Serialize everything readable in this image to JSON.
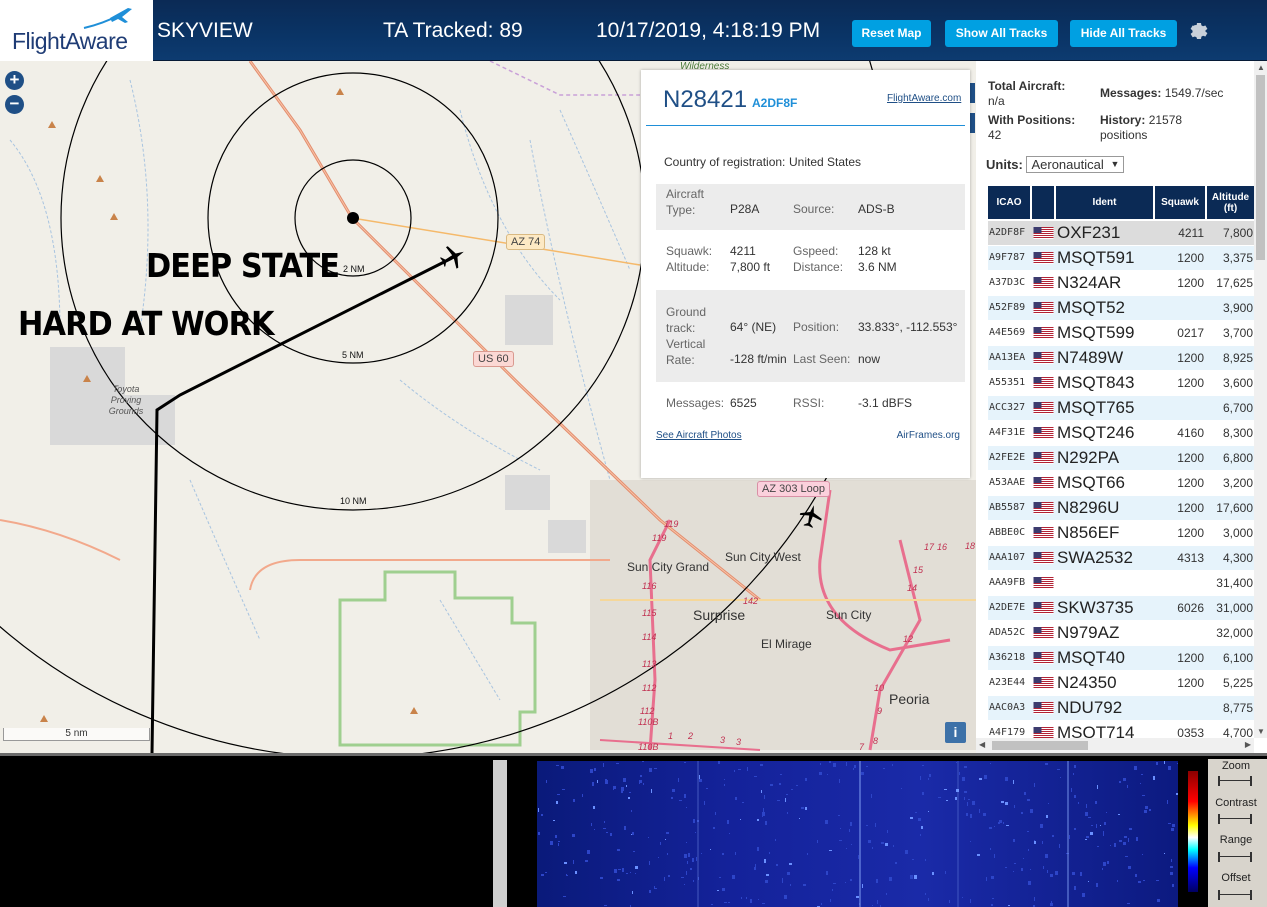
{
  "header": {
    "logo_text": "FlightAware",
    "site_name": "SKYVIEW",
    "tracked": "TA Tracked: 89",
    "datetime": "10/17/2019, 4:18:19 PM",
    "reset_label": "Reset Map",
    "show_label": "Show All Tracks",
    "hide_label": "Hide All Tracks",
    "settings_icon": "gear-icon"
  },
  "map": {
    "zoom_in": "+",
    "zoom_out": "−",
    "overlay_line1": "DEEP STATE",
    "overlay_line2": "HARD AT WORK",
    "ring_labels": [
      "2 NM",
      "5 NM",
      "10 NM"
    ],
    "road_labels": [
      "AZ 74",
      "US 60",
      "AZ 303 Loop"
    ],
    "places": [
      "Wilderness",
      "Toyota Proving Grounds",
      "Sun City West",
      "Sun City Grand",
      "Surprise",
      "Sun City",
      "El Mirage",
      "Peoria"
    ],
    "exit_numbers": [
      "119",
      "119",
      "116",
      "115",
      "114",
      "113",
      "112",
      "112",
      "110B",
      "110B",
      "142",
      "1",
      "2",
      "3",
      "3",
      "17",
      "16",
      "18",
      "15",
      "14",
      "12",
      "10",
      "9",
      "8",
      "7"
    ],
    "scale": "5 nm",
    "info_button": "i"
  },
  "popup": {
    "callsign": "N28421",
    "hex": "A2DF8F",
    "fa_link": "FlightAware.com",
    "country_label": "Country of registration:",
    "country": "United States",
    "aircraft_type_label": "Aircraft Type:",
    "aircraft_type": "P28A",
    "source_label": "Source:",
    "source": "ADS-B",
    "squawk_label": "Squawk:",
    "squawk": "4211",
    "gspeed_label": "Gspeed:",
    "gspeed": "128 kt",
    "altitude_label": "Altitude:",
    "altitude": "7,800 ft",
    "distance_label": "Distance:",
    "distance": "3.6 NM",
    "ground_track_label": "Ground track:",
    "ground_track": "64° (NE)",
    "position_label": "Position:",
    "position": "33.833°, -112.553°",
    "vertical_rate_label": "Vertical Rate:",
    "vertical_rate": "-128 ft/min",
    "last_seen_label": "Last Seen:",
    "last_seen": "now",
    "messages_label": "Messages:",
    "messages": "6525",
    "rssi_label": "RSSI:",
    "rssi": "-3.1 dBFS",
    "photos_link": "See Aircraft Photos",
    "airframes_link": "AirFrames.org"
  },
  "stats": {
    "total_label": "Total Aircraft:",
    "total": "n/a",
    "messages_label": "Messages:",
    "messages": "1549.7/sec",
    "positions_label": "With Positions:",
    "positions": "42",
    "history_label": "History:",
    "history": "21578",
    "history_unit": "positions",
    "units_label": "Units:",
    "units": "Aeronautical"
  },
  "table": {
    "headers": [
      "ICAO",
      "",
      "Ident",
      "Squawk",
      "Altitude (ft)"
    ],
    "rows": [
      {
        "icao": "A2DF8F",
        "ident": "OXF231",
        "squawk": "4211",
        "alt": "7,800"
      },
      {
        "icao": "A9F787",
        "ident": "MSQT591",
        "squawk": "1200",
        "alt": "3,375"
      },
      {
        "icao": "A37D3C",
        "ident": "N324AR",
        "squawk": "1200",
        "alt": "17,625"
      },
      {
        "icao": "A52F89",
        "ident": "MSQT52",
        "squawk": "",
        "alt": "3,900"
      },
      {
        "icao": "A4E569",
        "ident": "MSQT599",
        "squawk": "0217",
        "alt": "3,700"
      },
      {
        "icao": "AA13EA",
        "ident": "N7489W",
        "squawk": "1200",
        "alt": "8,925"
      },
      {
        "icao": "A55351",
        "ident": "MSQT843",
        "squawk": "1200",
        "alt": "3,600"
      },
      {
        "icao": "ACC327",
        "ident": "MSQT765",
        "squawk": "",
        "alt": "6,700"
      },
      {
        "icao": "A4F31E",
        "ident": "MSQT246",
        "squawk": "4160",
        "alt": "8,300"
      },
      {
        "icao": "A2FE2E",
        "ident": "N292PA",
        "squawk": "1200",
        "alt": "6,800"
      },
      {
        "icao": "A53AAE",
        "ident": "MSQT66",
        "squawk": "1200",
        "alt": "3,200"
      },
      {
        "icao": "AB5587",
        "ident": "N8296U",
        "squawk": "1200",
        "alt": "17,600"
      },
      {
        "icao": "ABBE0C",
        "ident": "N856EF",
        "squawk": "1200",
        "alt": "3,000"
      },
      {
        "icao": "AAA107",
        "ident": "SWA2532",
        "squawk": "4313",
        "alt": "4,300"
      },
      {
        "icao": "AAA9FB",
        "ident": "",
        "squawk": "",
        "alt": "31,400"
      },
      {
        "icao": "A2DE7E",
        "ident": "SKW3735",
        "squawk": "6026",
        "alt": "31,000"
      },
      {
        "icao": "ADA52C",
        "ident": "N979AZ",
        "squawk": "",
        "alt": "32,000"
      },
      {
        "icao": "A36218",
        "ident": "MSQT40",
        "squawk": "1200",
        "alt": "6,100"
      },
      {
        "icao": "A23E44",
        "ident": "N24350",
        "squawk": "1200",
        "alt": "5,225"
      },
      {
        "icao": "AAC0A3",
        "ident": "NDU792",
        "squawk": "",
        "alt": "8,775"
      },
      {
        "icao": "A4F179",
        "ident": "MSQT714",
        "squawk": "0353",
        "alt": "4,700"
      }
    ]
  },
  "spectrum": {
    "zoom_label": "Zoom",
    "contrast_label": "Contrast",
    "range_label": "Range",
    "offset_label": "Offset"
  },
  "colors": {
    "header_bg": "#0a3466",
    "button": "#00a0e2",
    "table_header": "#0b2a55",
    "selected_row": "#dcdcdc",
    "alt_row": "#e6f3fb"
  }
}
